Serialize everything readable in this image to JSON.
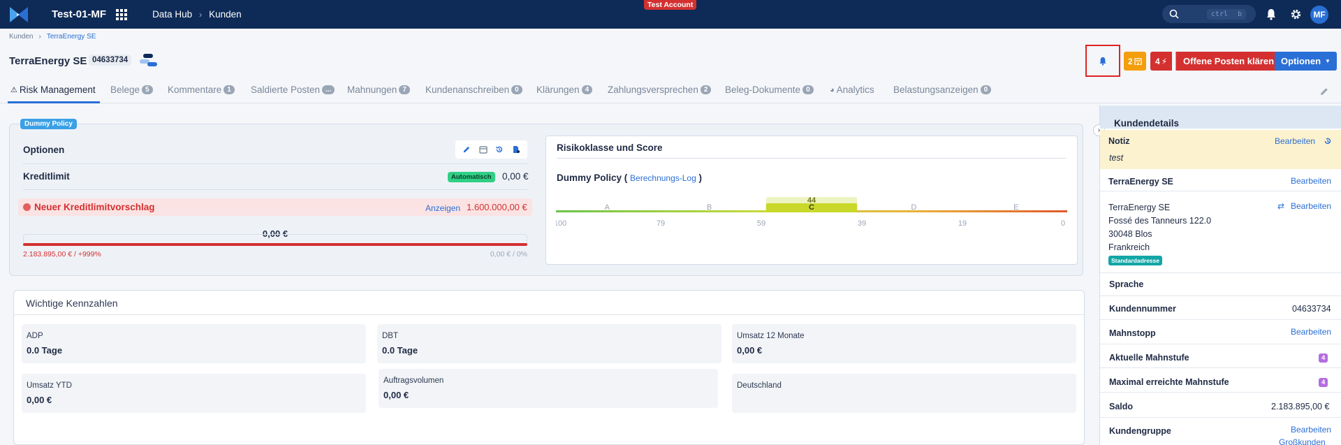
{
  "topbar": {
    "app_name": "Test-01-MF",
    "nav": [
      "Data Hub",
      "Kunden"
    ],
    "test_badge": "Test Account",
    "search_shortcut": "ctrl b",
    "avatar": "MF"
  },
  "breadcrumb": [
    "Kunden",
    "TerraEnergy SE"
  ],
  "header": {
    "title": "TerraEnergy SE",
    "customer_id": "04633734",
    "warn_count": "2",
    "open_count": "4",
    "open_button": "Offene Posten klären",
    "options_button": "Optionen"
  },
  "tabs": [
    {
      "label": "Risk Management",
      "count": ""
    },
    {
      "label": "Belege",
      "count": "5"
    },
    {
      "label": "Kommentare",
      "count": "1"
    },
    {
      "label": "Saldierte Posten",
      "count": "..."
    },
    {
      "label": "Mahnungen",
      "count": "7"
    },
    {
      "label": "Kundenanschreiben",
      "count": "0"
    },
    {
      "label": "Klärungen",
      "count": "4"
    },
    {
      "label": "Zahlungsversprechen",
      "count": "2"
    },
    {
      "label": "Beleg-Dokumente",
      "count": "0"
    },
    {
      "label": "Analytics",
      "count": ""
    },
    {
      "label": "Belastungsanzeigen",
      "count": "0"
    }
  ],
  "risk": {
    "policy_badge": "Dummy Policy",
    "options_title": "Optionen",
    "credit_limit_label": "Kreditlimit",
    "auto_badge": "Automatisch",
    "credit_limit_value": "0,00 €",
    "proposal_label": "Neuer Kreditlimitvorschlag",
    "proposal_link": "Anzeigen",
    "proposal_value": "1.600.000,00 €",
    "bar_center": "0,00 €",
    "bar_left": "2.183.895,00 € / +999%",
    "bar_right": "0,00 € / 0%",
    "bar_fill_fraction": 1.0
  },
  "score": {
    "title": "Risikoklasse und Score",
    "policy_name": "Dummy Policy",
    "log_link": "Berechnungs-Log",
    "classes": [
      "A",
      "B",
      "C",
      "D",
      "E"
    ],
    "ticks": [
      "100",
      "79",
      "59",
      "39",
      "19",
      "0"
    ],
    "active_class": "C",
    "score_value": "44"
  },
  "kpis": {
    "title": "Wichtige Kennzahlen",
    "items": [
      {
        "label": "ADP",
        "value": "0.0 Tage"
      },
      {
        "label": "DBT",
        "value": "0.0 Tage"
      },
      {
        "label": "Umsatz 12 Monate",
        "value": "0,00 €"
      },
      {
        "label": "Umsatz YTD",
        "value": "0,00 €"
      },
      {
        "label": "Auftragsvolumen",
        "value": "0,00 €"
      },
      {
        "label": "Deutschland",
        "value": ""
      }
    ]
  },
  "details": {
    "title": "Kundendetails",
    "note_label": "Notiz",
    "note_edit": "Bearbeiten",
    "note_text": "test",
    "company_label": "TerraEnergy SE",
    "edit": "Bearbeiten",
    "address": [
      "TerraEnergy SE",
      "Fossé des Tanneurs 122.0",
      "30048 Blos",
      "Frankreich"
    ],
    "std_badge": "Standardadresse",
    "language_label": "Sprache",
    "custno_label": "Kundennummer",
    "custno_value": "04633734",
    "stop_label": "Mahnstopp",
    "level_label": "Aktuelle Mahnstufe",
    "level_value": "4",
    "max_level_label": "Maximal erreichte Mahnstufe",
    "max_level_value": "4",
    "balance_label": "Saldo",
    "balance_value": "2.183.895,00 €",
    "group_label": "Kundengruppe",
    "group_value": "Großkunden"
  }
}
